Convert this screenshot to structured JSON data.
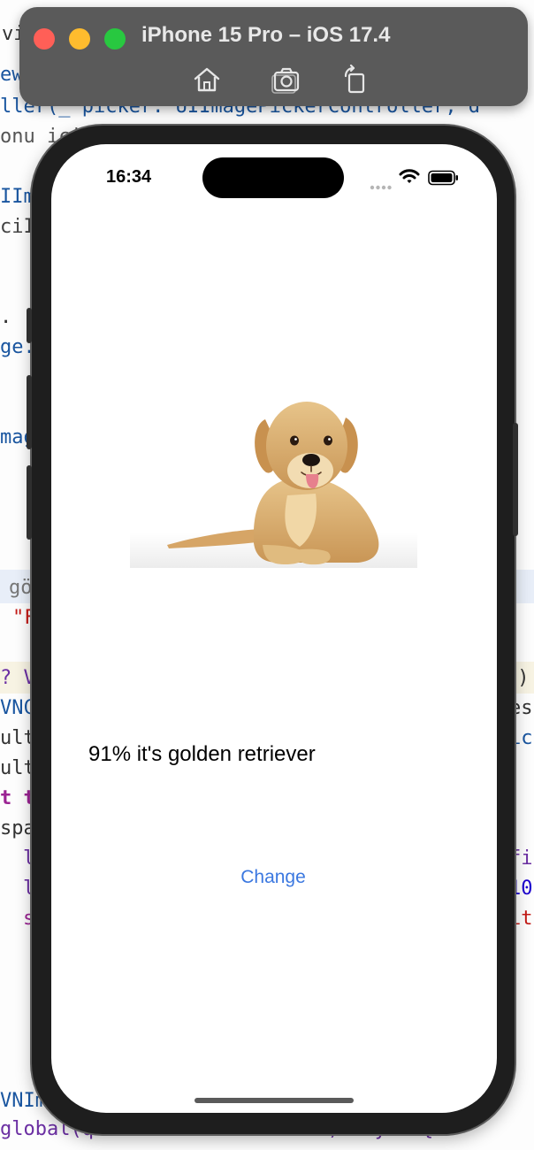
{
  "simulator": {
    "title": "iPhone 15 Pro – iOS 17.4",
    "toolbar": [
      {
        "name": "home-icon"
      },
      {
        "name": "screenshot-icon"
      },
      {
        "name": "rotate-icon"
      }
    ]
  },
  "editor_code_fragments": [
    {
      "text": "vi",
      "color": "#bdbdbd"
    },
    {
      "text": "ew",
      "color": "#1a56a0"
    },
    {
      "text": "ller(_ picker: UIImagePickerController, d",
      "color": "#1a56a0"
    },
    {
      "text": "onu ici",
      "color": "#555555"
    },
    {
      "text": "IIm",
      "color": "#1a56a0"
    },
    {
      "text": "ciI",
      "color": "#444444"
    },
    {
      "text": ".",
      "color": "#333333"
    },
    {
      "text": "ge.",
      "color": "#1a56a0"
    },
    {
      "text": "mag",
      "color": "#1a56a0"
    },
    {
      "text": "gö",
      "color": "#777777"
    },
    {
      "text": "\"F",
      "color": "#c41a16"
    },
    {
      "text": "? V",
      "color": "#6b2fa3"
    },
    {
      "text": "l)",
      "color": "#333333"
    },
    {
      "text": "VNC",
      "color": "#1a56a0"
    },
    {
      "text": "es",
      "color": "#333333"
    },
    {
      "text": "ult",
      "color": "#333333"
    },
    {
      "text": "ic",
      "color": "#1a56a0"
    },
    {
      "text": "ult",
      "color": "#333333"
    },
    {
      "text": "t t",
      "color": "#9b2393"
    },
    {
      "text": "spa",
      "color": "#333333"
    },
    {
      "text": "l",
      "color": "#6b2fa3"
    },
    {
      "text": "fi",
      "color": "#6b2fa3"
    },
    {
      "text": "l",
      "color": "#6b2fa3"
    },
    {
      "text": "10",
      "color": "#1c00cf"
    },
    {
      "text": "s",
      "color": "#9b2393"
    },
    {
      "text": "it",
      "color": "#c41a16"
    },
    {
      "text": "VNIm",
      "color": "#1a56a0"
    },
    {
      "text": "global(qos: .userInteractive).async {",
      "color": "#6b2fa3"
    }
  ],
  "phone": {
    "status_time": "16:34",
    "result_text": "91% it's golden retriever",
    "change_label": "Change",
    "image_subject": "golden retriever puppy"
  },
  "colors": {
    "accent": "#3b78e0",
    "titlebar": "#5a5a5a",
    "close": "#ff5f57",
    "minimize": "#febc2e",
    "zoom": "#28c840"
  }
}
